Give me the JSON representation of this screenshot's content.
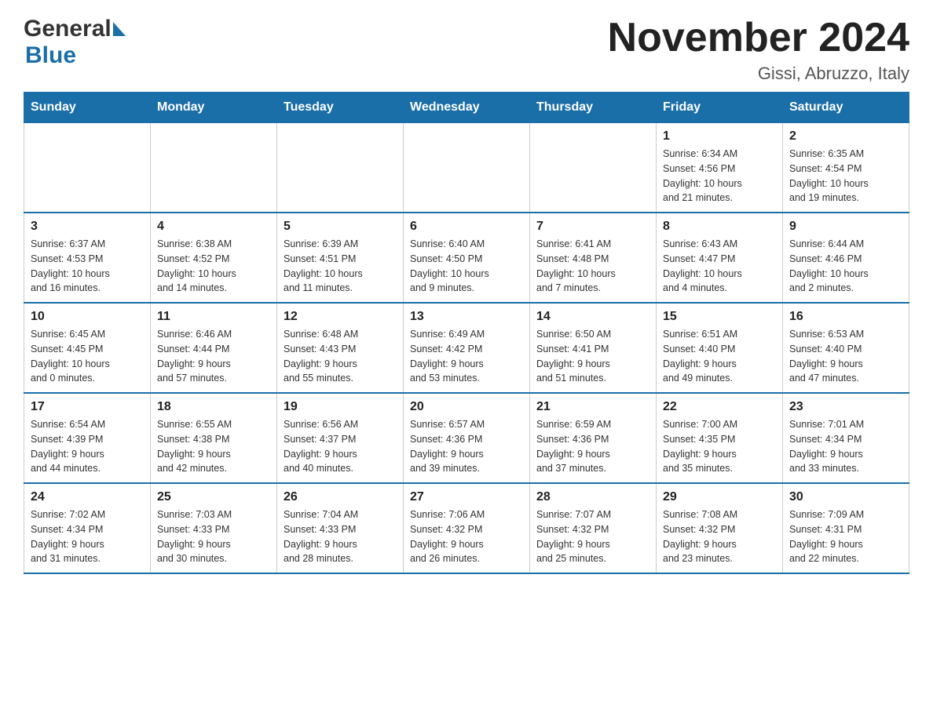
{
  "header": {
    "logo_general": "General",
    "logo_blue": "Blue",
    "month_title": "November 2024",
    "location": "Gissi, Abruzzo, Italy"
  },
  "weekdays": [
    "Sunday",
    "Monday",
    "Tuesday",
    "Wednesday",
    "Thursday",
    "Friday",
    "Saturday"
  ],
  "weeks": [
    [
      {
        "day": "",
        "info": ""
      },
      {
        "day": "",
        "info": ""
      },
      {
        "day": "",
        "info": ""
      },
      {
        "day": "",
        "info": ""
      },
      {
        "day": "",
        "info": ""
      },
      {
        "day": "1",
        "info": "Sunrise: 6:34 AM\nSunset: 4:56 PM\nDaylight: 10 hours\nand 21 minutes."
      },
      {
        "day": "2",
        "info": "Sunrise: 6:35 AM\nSunset: 4:54 PM\nDaylight: 10 hours\nand 19 minutes."
      }
    ],
    [
      {
        "day": "3",
        "info": "Sunrise: 6:37 AM\nSunset: 4:53 PM\nDaylight: 10 hours\nand 16 minutes."
      },
      {
        "day": "4",
        "info": "Sunrise: 6:38 AM\nSunset: 4:52 PM\nDaylight: 10 hours\nand 14 minutes."
      },
      {
        "day": "5",
        "info": "Sunrise: 6:39 AM\nSunset: 4:51 PM\nDaylight: 10 hours\nand 11 minutes."
      },
      {
        "day": "6",
        "info": "Sunrise: 6:40 AM\nSunset: 4:50 PM\nDaylight: 10 hours\nand 9 minutes."
      },
      {
        "day": "7",
        "info": "Sunrise: 6:41 AM\nSunset: 4:48 PM\nDaylight: 10 hours\nand 7 minutes."
      },
      {
        "day": "8",
        "info": "Sunrise: 6:43 AM\nSunset: 4:47 PM\nDaylight: 10 hours\nand 4 minutes."
      },
      {
        "day": "9",
        "info": "Sunrise: 6:44 AM\nSunset: 4:46 PM\nDaylight: 10 hours\nand 2 minutes."
      }
    ],
    [
      {
        "day": "10",
        "info": "Sunrise: 6:45 AM\nSunset: 4:45 PM\nDaylight: 10 hours\nand 0 minutes."
      },
      {
        "day": "11",
        "info": "Sunrise: 6:46 AM\nSunset: 4:44 PM\nDaylight: 9 hours\nand 57 minutes."
      },
      {
        "day": "12",
        "info": "Sunrise: 6:48 AM\nSunset: 4:43 PM\nDaylight: 9 hours\nand 55 minutes."
      },
      {
        "day": "13",
        "info": "Sunrise: 6:49 AM\nSunset: 4:42 PM\nDaylight: 9 hours\nand 53 minutes."
      },
      {
        "day": "14",
        "info": "Sunrise: 6:50 AM\nSunset: 4:41 PM\nDaylight: 9 hours\nand 51 minutes."
      },
      {
        "day": "15",
        "info": "Sunrise: 6:51 AM\nSunset: 4:40 PM\nDaylight: 9 hours\nand 49 minutes."
      },
      {
        "day": "16",
        "info": "Sunrise: 6:53 AM\nSunset: 4:40 PM\nDaylight: 9 hours\nand 47 minutes."
      }
    ],
    [
      {
        "day": "17",
        "info": "Sunrise: 6:54 AM\nSunset: 4:39 PM\nDaylight: 9 hours\nand 44 minutes."
      },
      {
        "day": "18",
        "info": "Sunrise: 6:55 AM\nSunset: 4:38 PM\nDaylight: 9 hours\nand 42 minutes."
      },
      {
        "day": "19",
        "info": "Sunrise: 6:56 AM\nSunset: 4:37 PM\nDaylight: 9 hours\nand 40 minutes."
      },
      {
        "day": "20",
        "info": "Sunrise: 6:57 AM\nSunset: 4:36 PM\nDaylight: 9 hours\nand 39 minutes."
      },
      {
        "day": "21",
        "info": "Sunrise: 6:59 AM\nSunset: 4:36 PM\nDaylight: 9 hours\nand 37 minutes."
      },
      {
        "day": "22",
        "info": "Sunrise: 7:00 AM\nSunset: 4:35 PM\nDaylight: 9 hours\nand 35 minutes."
      },
      {
        "day": "23",
        "info": "Sunrise: 7:01 AM\nSunset: 4:34 PM\nDaylight: 9 hours\nand 33 minutes."
      }
    ],
    [
      {
        "day": "24",
        "info": "Sunrise: 7:02 AM\nSunset: 4:34 PM\nDaylight: 9 hours\nand 31 minutes."
      },
      {
        "day": "25",
        "info": "Sunrise: 7:03 AM\nSunset: 4:33 PM\nDaylight: 9 hours\nand 30 minutes."
      },
      {
        "day": "26",
        "info": "Sunrise: 7:04 AM\nSunset: 4:33 PM\nDaylight: 9 hours\nand 28 minutes."
      },
      {
        "day": "27",
        "info": "Sunrise: 7:06 AM\nSunset: 4:32 PM\nDaylight: 9 hours\nand 26 minutes."
      },
      {
        "day": "28",
        "info": "Sunrise: 7:07 AM\nSunset: 4:32 PM\nDaylight: 9 hours\nand 25 minutes."
      },
      {
        "day": "29",
        "info": "Sunrise: 7:08 AM\nSunset: 4:32 PM\nDaylight: 9 hours\nand 23 minutes."
      },
      {
        "day": "30",
        "info": "Sunrise: 7:09 AM\nSunset: 4:31 PM\nDaylight: 9 hours\nand 22 minutes."
      }
    ]
  ]
}
